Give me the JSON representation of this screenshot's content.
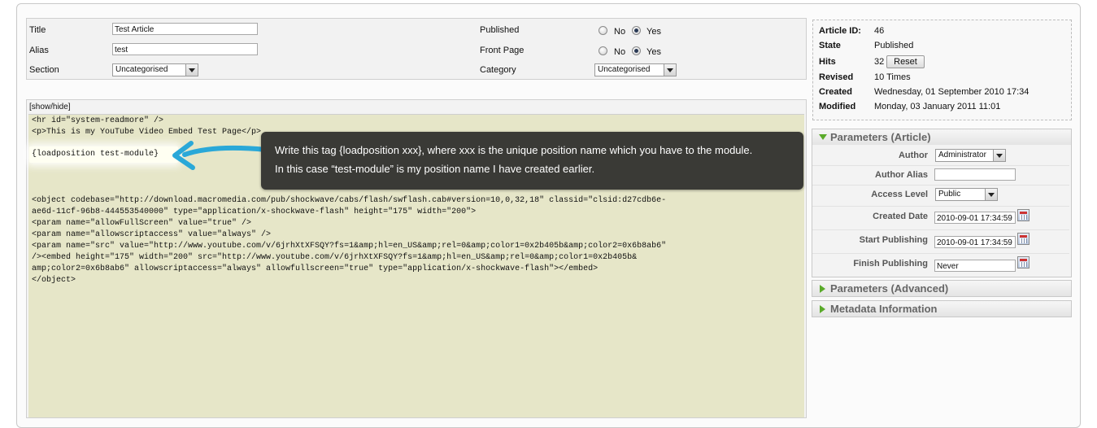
{
  "form": {
    "title_label": "Title",
    "title_value": "Test Article",
    "alias_label": "Alias",
    "alias_value": "test",
    "section_label": "Section",
    "section_value": "Uncategorised",
    "published_label": "Published",
    "frontpage_label": "Front Page",
    "category_label": "Category",
    "category_value": "Uncategorised",
    "no_label": "No",
    "yes_label": "Yes"
  },
  "editor": {
    "toggle_label": "[show/hide]",
    "lines": [
      "<hr id=\"system-readmore\" />",
      "<p>This is my YouTube Video Embed Test Page</p>",
      "{loadposition test-module}",
      "<object codebase=\"http://download.macromedia.com/pub/shockwave/cabs/flash/swflash.cab#version=10,0,32,18\" classid=\"clsid:d27cdb6e-",
      "ae6d-11cf-96b8-444553540000\" type=\"application/x-shockwave-flash\" height=\"175\" width=\"200\">",
      "<param name=\"allowFullScreen\" value=\"true\" />",
      "<param name=\"allowscriptaccess\" value=\"always\" />",
      "<param name=\"src\" value=\"http://www.youtube.com/v/6jrhXtXFSQY?fs=1&amp;hl=en_US&amp;rel=0&amp;color1=0x2b405b&amp;color2=0x6b8ab6\"",
      "/><embed height=\"175\" width=\"200\" src=\"http://www.youtube.com/v/6jrhXtXFSQY?fs=1&amp;hl=en_US&amp;rel=0&amp;color1=0x2b405b&",
      "amp;color2=0x6b8ab6\" allowscriptaccess=\"always\" allowfullscreen=\"true\" type=\"application/x-shockwave-flash\"></embed>",
      "</object>"
    ]
  },
  "tooltip": {
    "line1": "Write this tag {loadposition xxx}, where xxx is the unique position name which you have to the module.",
    "line2": "In this case “test-module” is my position name I have created earlier."
  },
  "info": {
    "article_id_label": "Article ID:",
    "article_id_value": "46",
    "state_label": "State",
    "state_value": "Published",
    "hits_label": "Hits",
    "hits_value": "32",
    "reset_label": "Reset",
    "revised_label": "Revised",
    "revised_value": "10 Times",
    "created_label": "Created",
    "created_value": "Wednesday, 01 September 2010 17:34",
    "modified_label": "Modified",
    "modified_value": "Monday, 03 January 2011 11:01"
  },
  "params": {
    "article_title": "Parameters (Article)",
    "author_label": "Author",
    "author_value": "Administrator",
    "author_alias_label": "Author Alias",
    "access_label": "Access Level",
    "access_value": "Public",
    "created_date_label": "Created Date",
    "created_date_value": "2010-09-01 17:34:59",
    "start_pub_label": "Start Publishing",
    "start_pub_value": "2010-09-01 17:34:59",
    "finish_pub_label": "Finish Publishing",
    "finish_pub_value": "Never",
    "advanced_title": "Parameters (Advanced)",
    "metadata_title": "Metadata Information"
  },
  "colors": {
    "editor_bg": "#e6e6c8",
    "tooltip_bg": "#3a3a36",
    "arrow": "#2aa8d8",
    "panel_triangle": "#5aaa2a"
  }
}
